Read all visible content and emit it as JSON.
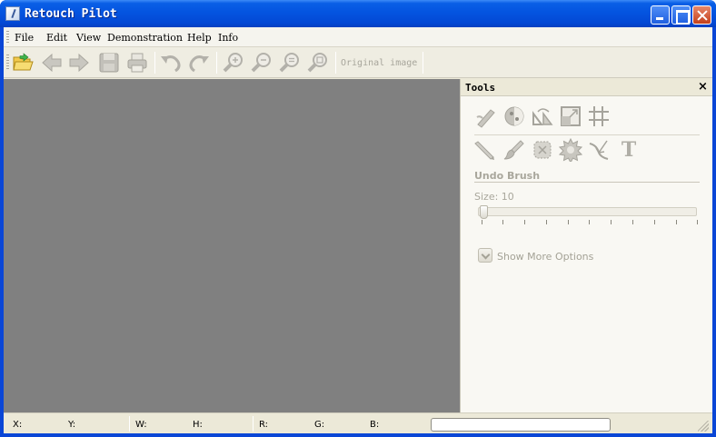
{
  "window": {
    "title": "Retouch Pilot"
  },
  "menu": {
    "items": [
      "File",
      "Edit",
      "View",
      "Demonstration",
      "Help",
      "Info"
    ]
  },
  "toolbar": {
    "original_label": "Original image",
    "icons": [
      "open-folder-icon",
      "back-arrow-icon",
      "forward-arrow-icon",
      "save-icon",
      "print-icon",
      "undo-icon",
      "redo-icon",
      "zoom-in-icon",
      "zoom-out-icon",
      "zoom-actual-icon",
      "zoom-fit-icon"
    ]
  },
  "tools_panel": {
    "title": "Tools",
    "close_glyph": "×",
    "row1_icons": [
      "retouch-icon",
      "color-correction-icon",
      "rotate-icon",
      "resize-icon",
      "crop-grid-icon"
    ],
    "row2_icons": [
      "pencil-icon",
      "brush-icon",
      "patch-icon",
      "blur-icon",
      "warp-icon",
      "text-icon"
    ],
    "text_tool_glyph": "T",
    "section_title": "Undo Brush",
    "size_label": "Size: 10",
    "size_value": 10,
    "show_more_label": "Show More Options"
  },
  "status_bar": {
    "x_label": "X:",
    "y_label": "Y:",
    "w_label": "W:",
    "h_label": "H:",
    "r_label": "R:",
    "g_label": "G:",
    "b_label": "B:"
  },
  "colors": {
    "titlebar": "#0454e0",
    "canvas": "#808080",
    "panel_bg": "#f9f8f3",
    "disabled_text": "#a9a79c"
  }
}
